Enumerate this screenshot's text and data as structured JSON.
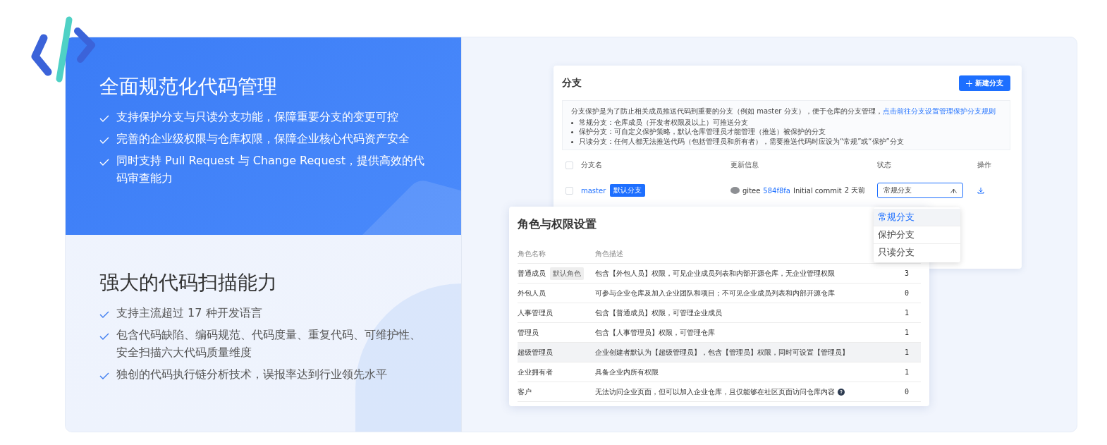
{
  "features": [
    {
      "title": "全面规范化代码管理",
      "selected": true,
      "items": [
        "支持保护分支与只读分支功能，保障重要分支的变更可控",
        "完善的企业级权限与仓库权限，保障企业核心代码资产安全",
        "同时支持 Pull Request 与 Change Request，提供高效的代码审查能力"
      ]
    },
    {
      "title": "强大的代码扫描能力",
      "selected": false,
      "items": [
        "支持主流超过 17 种开发语言",
        "包含代码缺陷、编码规范、代码度量、重复代码、可维护性、安全扫描六大代码质量维度",
        "独创的代码执行链分析技术，误报率达到行业领先水平"
      ]
    }
  ],
  "branch_panel": {
    "title": "分支",
    "new_button": "新建分支",
    "notice": {
      "text": "分支保护是为了防止相关成员推送代码到重要的分支（例如 master 分支），便于仓库的分支管理，",
      "link": "点击前往分支设置管理保护分支规则",
      "rules": [
        "常规分支：仓库成员（开发者权限及以上）可推送分支",
        "保护分支：可自定义保护策略，默认仓库管理员才能管理（推送）被保护的分支",
        "只读分支：任何人都无法推送代码（包括管理员和所有者），需要推送代码时应设为“常规”或“保护”分支"
      ]
    },
    "select_all_checked": false,
    "columns": [
      "分支名",
      "更新信息",
      "状态",
      "操作"
    ],
    "rows": [
      {
        "checked": false,
        "name": "master",
        "tag": "默认分支",
        "user": "gitee",
        "commit": "584f8fa",
        "message": "Initial commit",
        "time": "2 天前",
        "status": {
          "value": "常规分支",
          "expanded": true,
          "options": [
            {
              "label": "常规分支",
              "selected": true
            },
            {
              "label": "保护分支",
              "selected": false
            },
            {
              "label": "只读分支",
              "selected": false
            }
          ]
        }
      }
    ]
  },
  "roles_panel": {
    "title": "角色与权限设置",
    "columns": [
      "角色名称",
      "角色描述"
    ],
    "rows": [
      {
        "name": "普通成员",
        "badge": "默认角色",
        "description": "包含【外包人员】权限，可见企业成员列表和内部开源仓库，无企业管理权限",
        "count": "3",
        "highlighted": false,
        "help": false
      },
      {
        "name": "外包人员",
        "description": "可参与企业仓库及加入企业团队和项目；不可见企业成员列表和内部开源仓库",
        "count": "0",
        "highlighted": false,
        "help": false
      },
      {
        "name": "人事管理员",
        "description": "包含【普通成员】权限，可管理企业成员",
        "count": "1",
        "highlighted": false,
        "help": false
      },
      {
        "name": "管理员",
        "description": "包含【人事管理员】权限，可管理仓库",
        "count": "1",
        "highlighted": false,
        "help": false
      },
      {
        "name": "超级管理员",
        "description": "企业创建者默认为【超级管理员】，包含【管理员】权限，同时可设置【管理员】",
        "count": "1",
        "highlighted": true,
        "help": false
      },
      {
        "name": "企业拥有者",
        "description": "具备企业内所有权限",
        "count": "1",
        "highlighted": false,
        "help": false
      },
      {
        "name": "客户",
        "description": "无法访问企业页面，但可以加入企业仓库，且仅能够在社区页面访问仓库内容",
        "count": "0",
        "highlighted": false,
        "help": true
      }
    ]
  }
}
